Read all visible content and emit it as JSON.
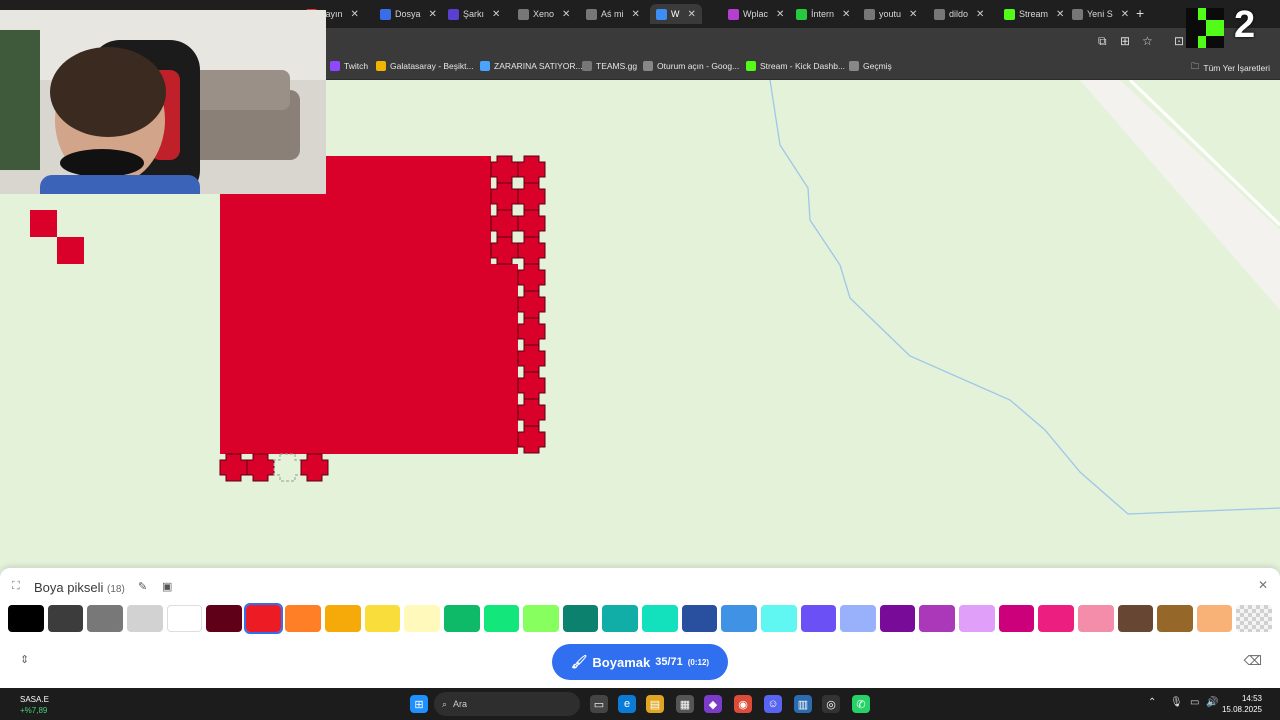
{
  "browser": {
    "tabs": [
      {
        "label": "",
        "color": "#6b6b6b"
      },
      {
        "label": "",
        "color": "#6b6b6b"
      },
      {
        "label": "",
        "color": "#6b6b6b"
      },
      {
        "label": "yayın",
        "color": "#e33"
      },
      {
        "label": "Dosya",
        "color": "#3a6ee8"
      },
      {
        "label": "Şarkı",
        "color": "#5a3fd1"
      },
      {
        "label": "Xeno",
        "color": "#777"
      },
      {
        "label": "Aś mi",
        "color": "#777"
      },
      {
        "label": "W",
        "color": "#3d8df5"
      },
      {
        "label": "Wplac",
        "color": "#b43fd1"
      },
      {
        "label": "İntern",
        "color": "#27c93f"
      },
      {
        "label": "youtu",
        "color": "#777"
      },
      {
        "label": "dildo",
        "color": "#777"
      },
      {
        "label": "Stream",
        "color": "#53fc18"
      },
      {
        "label": "Yeni S",
        "color": "#777"
      }
    ],
    "bookmarks": [
      {
        "label": "Twitch",
        "color": "#9146ff"
      },
      {
        "label": "Galatasaray - Beşikt...",
        "color": "#f2b400"
      },
      {
        "label": "ZARARINA SATIYOR...",
        "color": "#4aa3ff"
      },
      {
        "label": "TEAMS.gg",
        "color": "#777"
      },
      {
        "label": "Oturum açın - Goog...",
        "color": "#888"
      },
      {
        "label": "Stream - Kick Dashb...",
        "color": "#53fc18"
      },
      {
        "label": "Geçmiş",
        "color": "#888"
      }
    ],
    "bookmarks_right": "Tüm Yer İşaretleri"
  },
  "overlay": {
    "kick_number": "2"
  },
  "paint_panel": {
    "title": "Boya pikseli",
    "count": "(18)",
    "button_label": "Boyamak",
    "button_progress": "35/71",
    "button_time": "(0:12)",
    "selected_color": "#d9002a",
    "palette": [
      "#000000",
      "#3c3c3c",
      "#787878",
      "#d2d2d2",
      "#ffffff",
      "#600018",
      "#ed1c24",
      "#ff7f27",
      "#f6aa09",
      "#f9dd3b",
      "#fffabc",
      "#0eb968",
      "#13e67b",
      "#87ff5e",
      "#0c816e",
      "#10aea6",
      "#13e1be",
      "#28509e",
      "#4093e4",
      "#60f7f2",
      "#6b50f6",
      "#99b1fb",
      "#780c99",
      "#aa38b9",
      "#e09ff9",
      "#cb007a",
      "#ec1f80",
      "#f38da9",
      "#684634",
      "#95682a",
      "#f8b277",
      "transparent"
    ]
  },
  "taskbar": {
    "stock_name": "SASA.E",
    "stock_change": "+%7,89",
    "search_label": "Ara",
    "time": "14:53",
    "date": "15.08.2025"
  }
}
